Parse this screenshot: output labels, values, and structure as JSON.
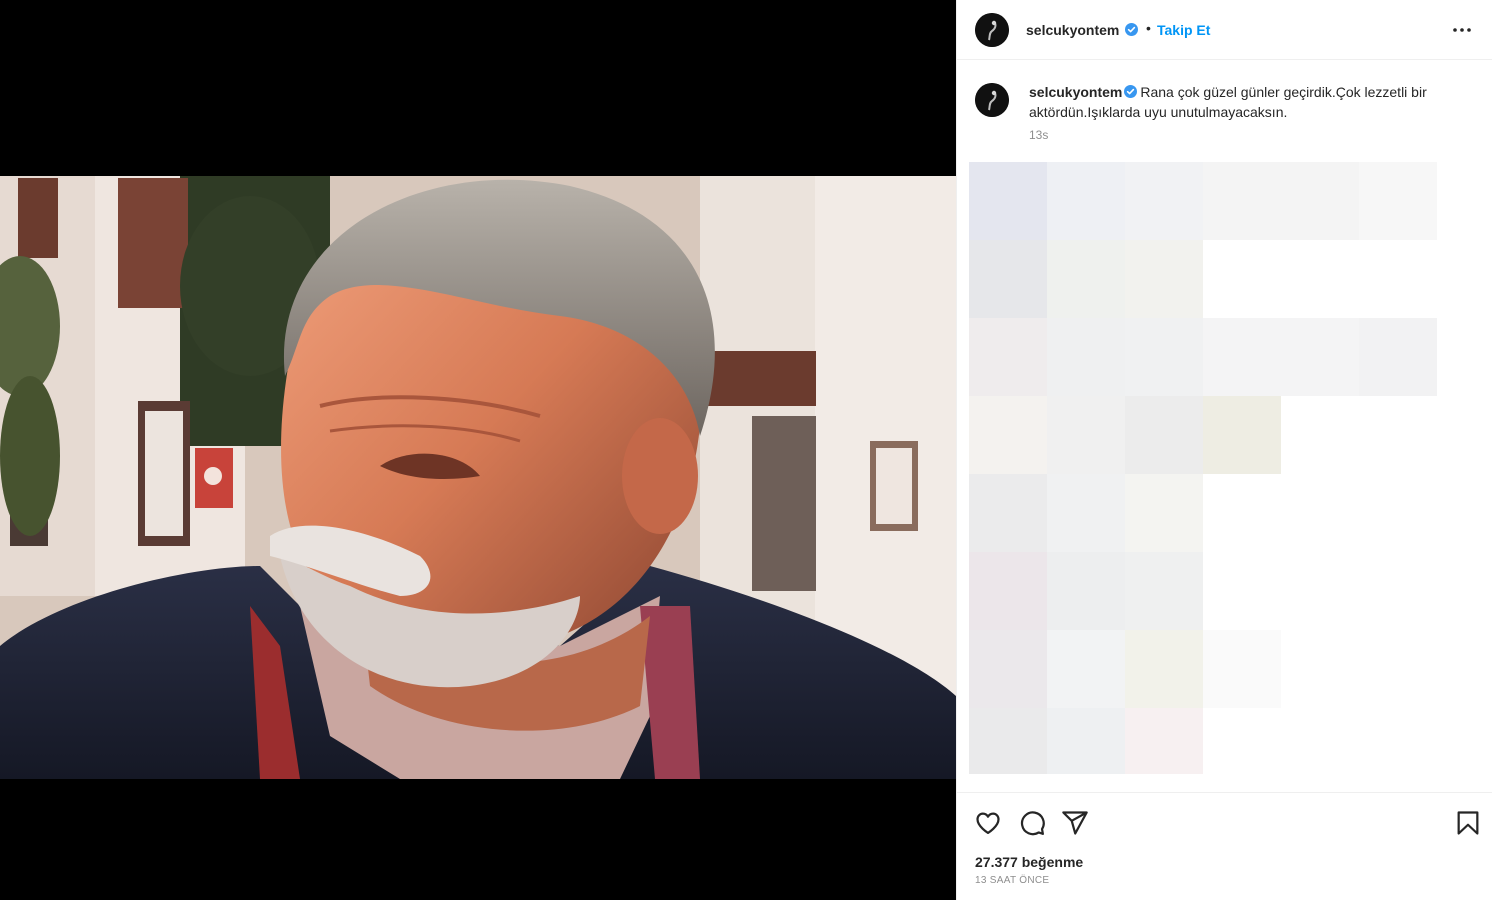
{
  "post": {
    "username": "selcukyontem",
    "separator": "•",
    "follow_label": "Takip Et",
    "more_icon": "more-options-icon",
    "verified_icon": "verified-badge-icon",
    "image_alt": "photo"
  },
  "caption": {
    "username": "selcukyontem",
    "text": "Rana çok güzel günler geçirdik.Çok lezzetli bir aktördün.Işıklarda uyu unutulmayacaksın.",
    "age": "13s"
  },
  "actions": {
    "icons": [
      "heart-icon",
      "comment-icon",
      "share-icon",
      "bookmark-icon"
    ],
    "likes": "27.377 beğenme",
    "timestamp": "13 SAAT ÖNCE"
  },
  "colors": {
    "link_blue": "#0095f6",
    "verified_blue": "#3897f0",
    "muted_text": "#8e8e8e",
    "border": "#efefef"
  }
}
